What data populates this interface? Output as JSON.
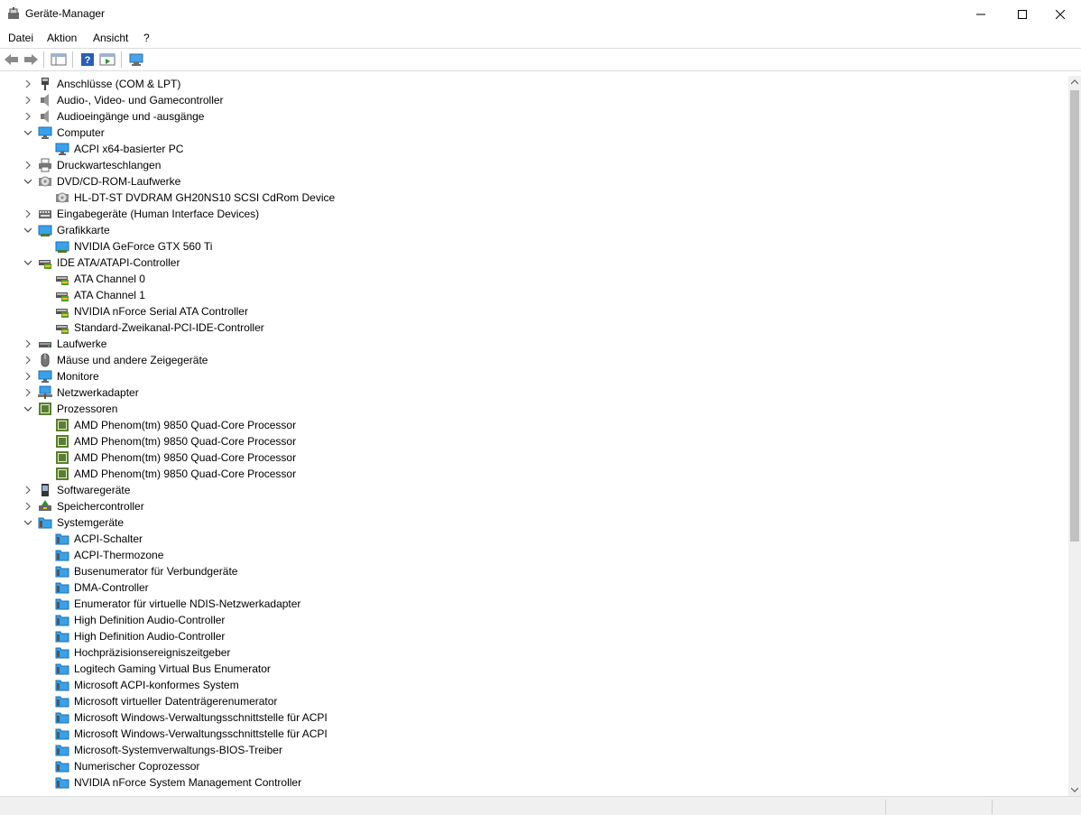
{
  "window": {
    "title": "Geräte-Manager"
  },
  "menu": [
    "Datei",
    "Aktion",
    "Ansicht",
    "?"
  ],
  "colors": {
    "accent": "#1e7fd8",
    "chip_green": "#5a7f2c",
    "tree_text": "#000000"
  },
  "tree": [
    {
      "label": "Anschlüsse (COM & LPT)",
      "level": 0,
      "expander": "collapsed",
      "icon": "port-icon"
    },
    {
      "label": "Audio-, Video- und Gamecontroller",
      "level": 0,
      "expander": "collapsed",
      "icon": "speaker-icon"
    },
    {
      "label": "Audioeingänge und -ausgänge",
      "level": 0,
      "expander": "collapsed",
      "icon": "speaker-icon"
    },
    {
      "label": "Computer",
      "level": 0,
      "expander": "expanded",
      "icon": "monitor-icon"
    },
    {
      "label": "ACPI x64-basierter PC",
      "level": 1,
      "expander": "none",
      "icon": "monitor-icon"
    },
    {
      "label": "Druckwarteschlangen",
      "level": 0,
      "expander": "collapsed",
      "icon": "printer-icon"
    },
    {
      "label": "DVD/CD-ROM-Laufwerke",
      "level": 0,
      "expander": "expanded",
      "icon": "disc-icon"
    },
    {
      "label": "HL-DT-ST DVDRAM GH20NS10 SCSI CdRom Device",
      "level": 1,
      "expander": "none",
      "icon": "disc-icon"
    },
    {
      "label": "Eingabegeräte (Human Interface Devices)",
      "level": 0,
      "expander": "collapsed",
      "icon": "keyboard-icon"
    },
    {
      "label": "Grafikkarte",
      "level": 0,
      "expander": "expanded",
      "icon": "display-adapter-icon"
    },
    {
      "label": "NVIDIA GeForce GTX 560 Ti",
      "level": 1,
      "expander": "none",
      "icon": "display-adapter-icon"
    },
    {
      "label": "IDE ATA/ATAPI-Controller",
      "level": 0,
      "expander": "expanded",
      "icon": "ide-controller-icon"
    },
    {
      "label": "ATA Channel 0",
      "level": 1,
      "expander": "none",
      "icon": "ide-controller-icon"
    },
    {
      "label": "ATA Channel 1",
      "level": 1,
      "expander": "none",
      "icon": "ide-controller-icon"
    },
    {
      "label": "NVIDIA nForce Serial ATA Controller",
      "level": 1,
      "expander": "none",
      "icon": "ide-controller-icon"
    },
    {
      "label": "Standard-Zweikanal-PCI-IDE-Controller",
      "level": 1,
      "expander": "none",
      "icon": "ide-controller-icon"
    },
    {
      "label": "Laufwerke",
      "level": 0,
      "expander": "collapsed",
      "icon": "drive-icon"
    },
    {
      "label": "Mäuse und andere Zeigegeräte",
      "level": 0,
      "expander": "collapsed",
      "icon": "mouse-icon"
    },
    {
      "label": "Monitore",
      "level": 0,
      "expander": "collapsed",
      "icon": "monitor-icon"
    },
    {
      "label": "Netzwerkadapter",
      "level": 0,
      "expander": "collapsed",
      "icon": "network-icon"
    },
    {
      "label": "Prozessoren",
      "level": 0,
      "expander": "expanded",
      "icon": "processor-icon"
    },
    {
      "label": "AMD Phenom(tm) 9850 Quad-Core Processor",
      "level": 1,
      "expander": "none",
      "icon": "processor-icon"
    },
    {
      "label": "AMD Phenom(tm) 9850 Quad-Core Processor",
      "level": 1,
      "expander": "none",
      "icon": "processor-icon"
    },
    {
      "label": "AMD Phenom(tm) 9850 Quad-Core Processor",
      "level": 1,
      "expander": "none",
      "icon": "processor-icon"
    },
    {
      "label": "AMD Phenom(tm) 9850 Quad-Core Processor",
      "level": 1,
      "expander": "none",
      "icon": "processor-icon"
    },
    {
      "label": "Softwaregeräte",
      "level": 0,
      "expander": "collapsed",
      "icon": "software-device-icon"
    },
    {
      "label": "Speichercontroller",
      "level": 0,
      "expander": "collapsed",
      "icon": "storage-controller-icon"
    },
    {
      "label": "Systemgeräte",
      "level": 0,
      "expander": "expanded",
      "icon": "system-folder-icon"
    },
    {
      "label": "ACPI-Schalter",
      "level": 1,
      "expander": "none",
      "icon": "system-folder-icon"
    },
    {
      "label": "ACPI-Thermozone",
      "level": 1,
      "expander": "none",
      "icon": "system-folder-icon"
    },
    {
      "label": "Busenumerator für Verbundgeräte",
      "level": 1,
      "expander": "none",
      "icon": "system-folder-icon"
    },
    {
      "label": "DMA-Controller",
      "level": 1,
      "expander": "none",
      "icon": "system-folder-icon"
    },
    {
      "label": "Enumerator für virtuelle NDIS-Netzwerkadapter",
      "level": 1,
      "expander": "none",
      "icon": "system-folder-icon"
    },
    {
      "label": "High Definition Audio-Controller",
      "level": 1,
      "expander": "none",
      "icon": "system-folder-icon"
    },
    {
      "label": "High Definition Audio-Controller",
      "level": 1,
      "expander": "none",
      "icon": "system-folder-icon"
    },
    {
      "label": "Hochpräzisionsereigniszeitgeber",
      "level": 1,
      "expander": "none",
      "icon": "system-folder-icon"
    },
    {
      "label": "Logitech Gaming Virtual Bus Enumerator",
      "level": 1,
      "expander": "none",
      "icon": "system-folder-icon"
    },
    {
      "label": "Microsoft ACPI-konformes System",
      "level": 1,
      "expander": "none",
      "icon": "system-folder-icon"
    },
    {
      "label": "Microsoft virtueller Datenträgerenumerator",
      "level": 1,
      "expander": "none",
      "icon": "system-folder-icon"
    },
    {
      "label": "Microsoft Windows-Verwaltungsschnittstelle für ACPI",
      "level": 1,
      "expander": "none",
      "icon": "system-folder-icon"
    },
    {
      "label": "Microsoft Windows-Verwaltungsschnittstelle für ACPI",
      "level": 1,
      "expander": "none",
      "icon": "system-folder-icon"
    },
    {
      "label": "Microsoft-Systemverwaltungs-BIOS-Treiber",
      "level": 1,
      "expander": "none",
      "icon": "system-folder-icon"
    },
    {
      "label": "Numerischer Coprozessor",
      "level": 1,
      "expander": "none",
      "icon": "system-folder-icon"
    },
    {
      "label": "NVIDIA nForce System Management Controller",
      "level": 1,
      "expander": "none",
      "icon": "system-folder-icon"
    }
  ]
}
